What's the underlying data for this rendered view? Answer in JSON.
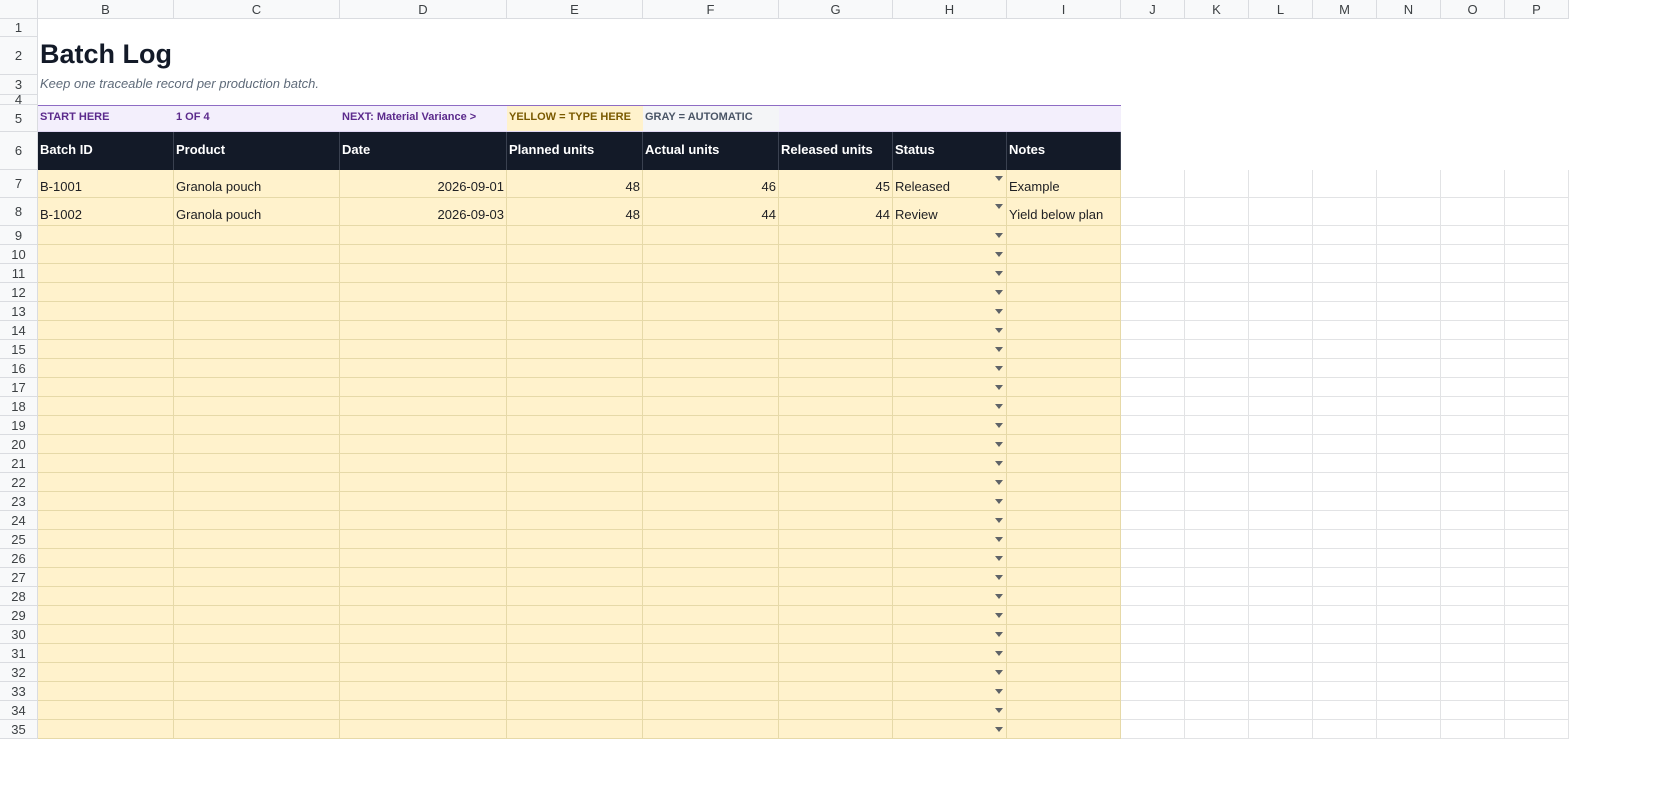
{
  "sheet": {
    "columns": [
      "B",
      "C",
      "D",
      "E",
      "F",
      "G",
      "H",
      "I",
      "J",
      "K",
      "L",
      "M",
      "N",
      "O",
      "P"
    ],
    "rows": [
      "1",
      "2",
      "3",
      "4",
      "5",
      "6",
      "7",
      "8",
      "9",
      "10",
      "11",
      "12",
      "13",
      "14",
      "15",
      "16",
      "17",
      "18",
      "19",
      "20",
      "21",
      "22",
      "23",
      "24",
      "25",
      "26",
      "27",
      "28",
      "29",
      "30",
      "31",
      "32",
      "33",
      "34",
      "35"
    ],
    "title": "Batch Log",
    "subtitle": "Keep one traceable record per production batch.",
    "nav": {
      "start": "START HERE",
      "step": "1 OF 4",
      "next": "NEXT: Material Variance  >",
      "legend_yellow": "YELLOW = TYPE HERE",
      "legend_gray": "GRAY = AUTOMATIC"
    },
    "table_headers": [
      "Batch ID",
      "Product",
      "Date",
      "Planned units",
      "Actual units",
      "Released units",
      "Status",
      "Notes"
    ],
    "table_rows": [
      [
        "B-1001",
        "Granola pouch",
        "2026-09-01",
        "48",
        "46",
        "45",
        "Released",
        "Example"
      ],
      [
        "B-1002",
        "Granola pouch",
        "2026-09-03",
        "48",
        "44",
        "44",
        "Review",
        "Yield below plan"
      ]
    ],
    "empty_rows": 27,
    "status_options_visible": [
      "Released",
      "Review"
    ],
    "dropdown_icon": "chevron-down-icon",
    "colors": {
      "input_fill": "#fff2cc",
      "header_fill": "#131a28",
      "nav_fill": "#f3effc",
      "nav_text": "#5b2a8c"
    }
  }
}
